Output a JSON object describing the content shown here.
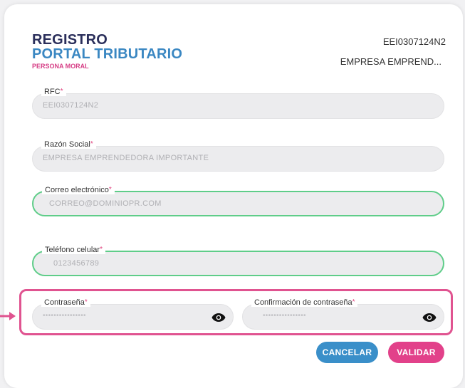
{
  "brand": {
    "line1": "REGISTRO",
    "line2": "PORTAL TRIBUTARIO",
    "subtitle": "PERSONA MORAL"
  },
  "header": {
    "rfc": "EEI0307124N2",
    "company": "EMPRESA EMPREND..."
  },
  "required_mark": "*",
  "fields": {
    "rfc": {
      "label": "RFC",
      "value": "EEI0307124N2"
    },
    "razon_social": {
      "label": "Razón Social",
      "value": "EMPRESA EMPRENDEDORA IMPORTANTE"
    },
    "correo": {
      "label": "Correo electrónico",
      "placeholder": "CORREO@DOMINIOPR.COM"
    },
    "telefono": {
      "label": "Teléfono celular",
      "placeholder": "0123456789"
    },
    "password": {
      "label": "Contraseña",
      "placeholder": "••••••••••••••••"
    },
    "password_confirm": {
      "label": "Confirmación de contraseña",
      "placeholder": "••••••••••••••••"
    }
  },
  "buttons": {
    "cancel": "CANCELAR",
    "validate": "VALIDAR"
  },
  "colors": {
    "brand_dark": "#2b2f5b",
    "brand_blue": "#3a87c2",
    "brand_pink": "#d63f86",
    "active_border": "#5fcd89",
    "highlight": "#e05390",
    "cancel_bg": "#3a8fc9",
    "validate_bg": "#e2418a"
  },
  "icons": [
    "eye-icon",
    "arrow-right-icon"
  ]
}
